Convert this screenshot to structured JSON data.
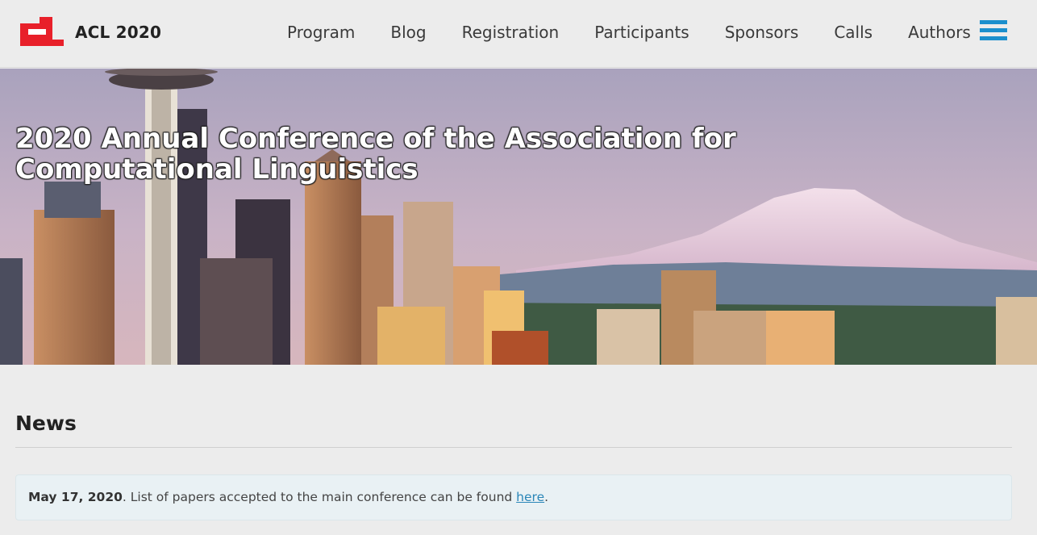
{
  "site": {
    "title": "ACL 2020",
    "brand_color": "#e8202a"
  },
  "nav": {
    "items": [
      "Program",
      "Blog",
      "Registration",
      "Participants",
      "Sponsors",
      "Calls",
      "Authors"
    ],
    "menu_icon": "hamburger-icon",
    "menu_color": "#1b8fcd"
  },
  "hero": {
    "title": "2020 Annual Conference of the Association for Computational Linguistics"
  },
  "news": {
    "heading": "News",
    "items": [
      {
        "date": "May 17, 2020",
        "text": ". List of papers accepted to the main conference can be found ",
        "link": "here",
        "after": "."
      }
    ]
  }
}
